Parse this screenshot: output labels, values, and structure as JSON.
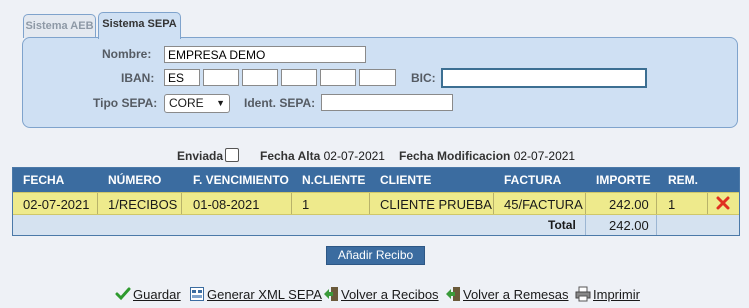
{
  "tabs": [
    {
      "label": "Sistema AEB",
      "active": false
    },
    {
      "label": "Sistema SEPA",
      "active": true
    }
  ],
  "form": {
    "nombre_label": "Nombre:",
    "nombre_value": "EMPRESA DEMO",
    "iban_label": "IBAN:",
    "iban_parts": [
      "ES",
      "",
      "",
      "",
      "",
      ""
    ],
    "bic_label": "BIC:",
    "bic_value": "",
    "tipo_label": "Tipo SEPA:",
    "tipo_value": "CORE",
    "ident_label": "Ident. SEPA:",
    "ident_value": ""
  },
  "info": {
    "enviada_label": "Enviada",
    "enviada_checked": false,
    "fecha_alta_label": "Fecha Alta",
    "fecha_alta_value": "02-07-2021",
    "fecha_mod_label": "Fecha Modificacion",
    "fecha_mod_value": "02-07-2021"
  },
  "table": {
    "headers": [
      "FECHA",
      "NÚMERO",
      "F. VENCIMIENTO",
      "N.CLIENTE",
      "CLIENTE",
      "FACTURA",
      "IMPORTE",
      "REM."
    ],
    "rows": [
      {
        "fecha": "02-07-2021",
        "numero": "1/RECIBOS",
        "vencimiento": "01-08-2021",
        "ncliente": "1",
        "cliente": "CLIENTE PRUEBA",
        "factura": "45/FACTURA",
        "importe": "242.00",
        "rem": "1"
      }
    ],
    "total_label": "Total",
    "total_value": "242.00"
  },
  "add_button": "Añadir Recibo",
  "links": [
    {
      "label": "Guardar",
      "icon": "check-icon"
    },
    {
      "label": "Generar XML SEPA",
      "icon": "xml-icon"
    },
    {
      "label": "Volver a Recibos",
      "icon": "back-arrow-icon"
    },
    {
      "label": "Volver a Remesas",
      "icon": "back-arrow-icon"
    },
    {
      "label": "Imprimir",
      "icon": "printer-icon"
    }
  ],
  "colors": {
    "panel": "#cfe0f3",
    "header": "#3b6ca0",
    "row_highlight": "#eeea8c",
    "delete": "#e03020"
  }
}
